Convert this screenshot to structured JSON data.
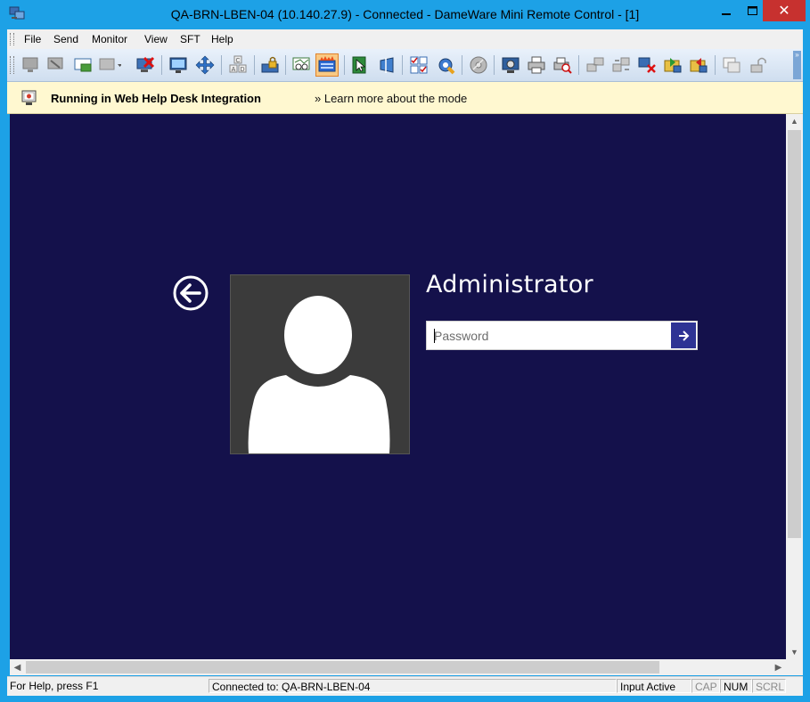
{
  "window": {
    "title": "QA-BRN-LBEN-04 (10.140.27.9) - Connected - DameWare Mini Remote Control - [1]",
    "icon": "remote-control-app-icon",
    "controls": {
      "minimize": "▁",
      "maximize": "□",
      "close": "✕"
    }
  },
  "menu": {
    "items": [
      {
        "label": "File"
      },
      {
        "label": "Send"
      },
      {
        "label": "Monitor"
      },
      {
        "label": "View"
      },
      {
        "label": "SFT"
      },
      {
        "label": "Help"
      }
    ]
  },
  "toolbar": {
    "overflow_glyph": "»",
    "icons": [
      "connect-icon",
      "disconnect-icon",
      "chat-icon",
      "send-keys-icon",
      "disconnect-red-icon",
      "monitor-icon",
      "move-icon",
      "keyboard-abc-icon",
      "lock-workstation-icon",
      "view-only-icon",
      "input-active-icon",
      "pointer-icon",
      "screen-select-icon",
      "settings-checklist-icon",
      "tools-icon",
      "disk-icon",
      "screenshot-icon",
      "print-icon",
      "print-preview-icon",
      "network-icon",
      "network-transfer-icon",
      "network-disconnect-icon",
      "file-transfer-icon",
      "file-transfer-out-icon",
      "windows-icon",
      "unlock-icon"
    ]
  },
  "infobar": {
    "message": "Running in Web Help Desk Integration",
    "link": "» Learn more about the mode"
  },
  "remote_screen": {
    "username": "Administrator",
    "password_placeholder": "Password",
    "background_color": "#14114b",
    "submit_color": "#2e3394"
  },
  "statusbar": {
    "help": "For Help, press F1",
    "connection": "Connected to: QA-BRN-LBEN-04",
    "input": "Input Active",
    "cap": "CAP",
    "num": "NUM",
    "scrl": "SCRL"
  }
}
